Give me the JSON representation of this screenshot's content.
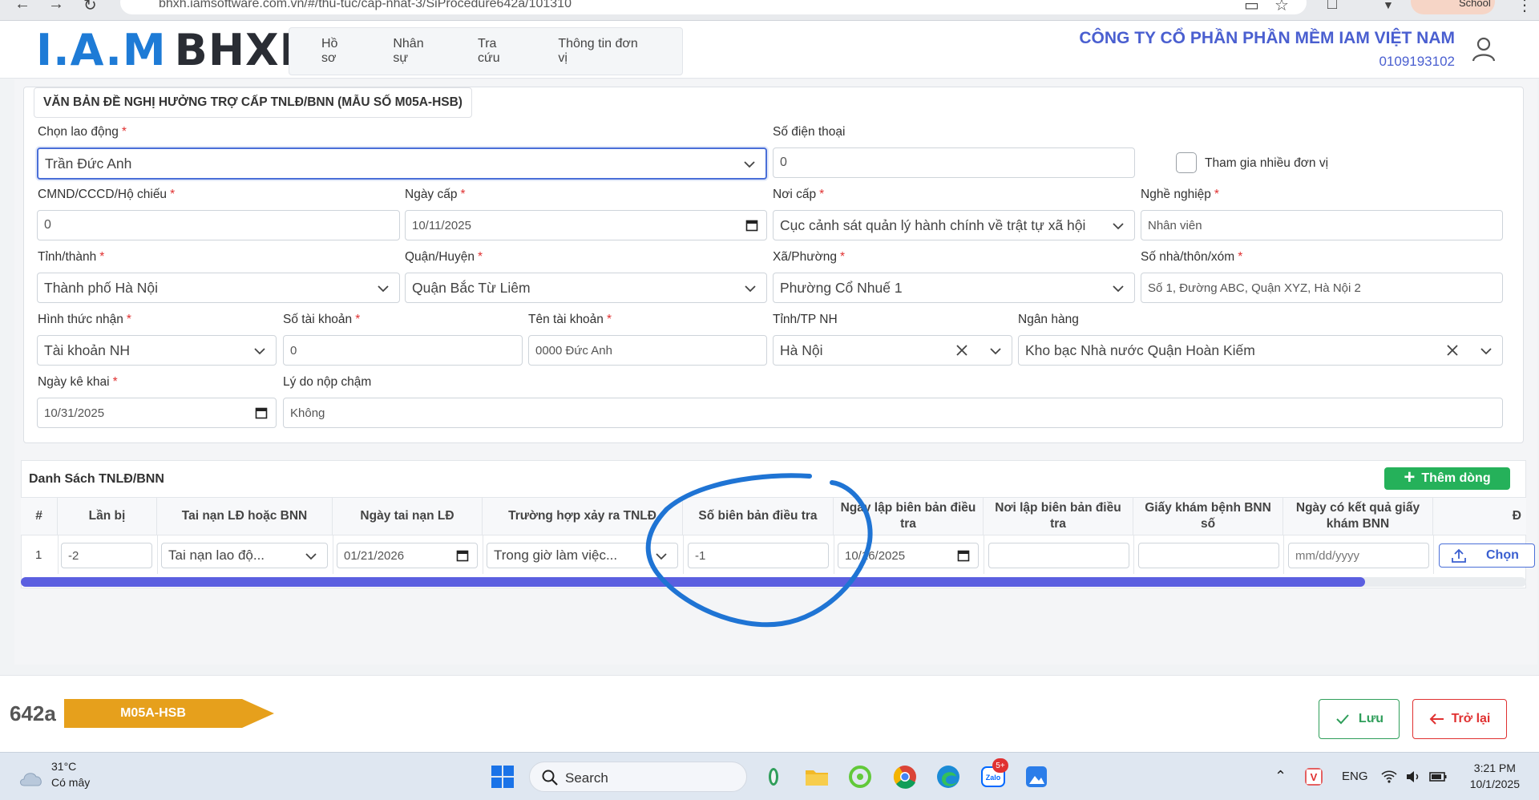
{
  "browser": {
    "url": "bhxh.iamsoftware.com.vn/#/thu-tuc/cap-nhat-3/SiProcedure642a/101310",
    "profile": "School"
  },
  "header": {
    "logo_iam": "I.A.M",
    "logo_bhxh": "BHXH",
    "nav": [
      "Hồ sơ",
      "Nhân sự",
      "Tra cứu",
      "Thông tin đơn vị"
    ],
    "company_name": "CÔNG TY CỔ PHẦN PHẦN MỀM IAM VIỆT NAM",
    "company_tax": "0109193102"
  },
  "form": {
    "title": "VĂN BẢN ĐỀ NGHỊ HƯỞNG TRỢ CẤP TNLĐ/BNN (MẪU SỐ M05A-HSB)",
    "employee_label": "Chọn lao động",
    "employee_value": "Trần Đức Anh",
    "phone_label": "Số điện thoại",
    "phone_value": "0",
    "multi_unit_label": "Tham gia nhiều đơn vị",
    "id_label": "CMND/CCCD/Hộ chiếu",
    "id_value": "0",
    "issue_date_label": "Ngày cấp",
    "issue_date_value": "10/11/2025",
    "issue_place_label": "Nơi cấp",
    "issue_place_value": "Cục cảnh sát quản lý hành chính về trật tự xã hội",
    "job_label": "Nghề nghiệp",
    "job_value": "Nhân viên",
    "province_label": "Tỉnh/thành",
    "province_value": "Thành phố Hà Nội",
    "district_label": "Quận/Huyện",
    "district_value": "Quận Bắc Từ Liêm",
    "ward_label": "Xã/Phường",
    "ward_value": "Phường Cổ Nhuế 1",
    "address_label": "Số nhà/thôn/xóm",
    "address_value": "Số 1, Đường ABC, Quận XYZ, Hà Nội 2",
    "receive_label": "Hình thức nhận",
    "receive_value": "Tài khoản NH",
    "account_no_label": "Số tài khoản",
    "account_no_value": "0",
    "account_name_label": "Tên tài khoản",
    "account_name_value": "0000 Đức Anh",
    "bank_province_label": "Tỉnh/TP NH",
    "bank_province_value": "Hà Nội",
    "bank_label": "Ngân hàng",
    "bank_value": "Kho bạc Nhà nước Quận Hoàn Kiếm",
    "declare_date_label": "Ngày kê khai",
    "declare_date_value": "10/31/2025",
    "late_reason_label": "Lý do nộp chậm",
    "late_reason_value": "Không"
  },
  "table": {
    "title": "Danh Sách TNLĐ/BNN",
    "add_label": "Thêm dòng",
    "headers": [
      "#",
      "Lần bị",
      "Tai nạn LĐ hoặc BNN",
      "Ngày tai nạn LĐ",
      "Trường hợp xảy ra TNLĐ",
      "Số biên bản điều tra",
      "Ngày lập biên bản điều tra",
      "Nơi lập biên bản điều tra",
      "Giấy khám bệnh BNN số",
      "Ngày có kết quả giấy khám BNN",
      "Đ"
    ],
    "row": {
      "num": "1",
      "times": "-2",
      "type": "Tai nạn lao độ...",
      "accident_date": "01/21/2026",
      "case": "Trong giờ làm việc...",
      "report_no": "-1",
      "report_date": "10/16/2025",
      "report_place": "",
      "exam_no": "",
      "exam_date_placeholder": "mm/dd/yyyy",
      "upload_label": "Chọn"
    },
    "scroll_fraction": 0.893
  },
  "footer": {
    "doc_number": "642a",
    "doc_code": "M05A-HSB",
    "save_label": "Lưu",
    "back_label": "Trở lại"
  },
  "taskbar": {
    "temperature": "31°C",
    "condition": "Có mây",
    "search_label": "Search",
    "language": "ENG",
    "time": "3:21 PM",
    "date": "10/1/2025",
    "badge": "5+"
  },
  "colors": {
    "accent": "#4a5fd0",
    "logo_blue": "#1e7bd6",
    "success": "#25b15a",
    "danger": "#e03131",
    "doc_badge": "#e6a01c",
    "scrollbar": "#5b5fe0",
    "annotation": "#1f74d4"
  }
}
